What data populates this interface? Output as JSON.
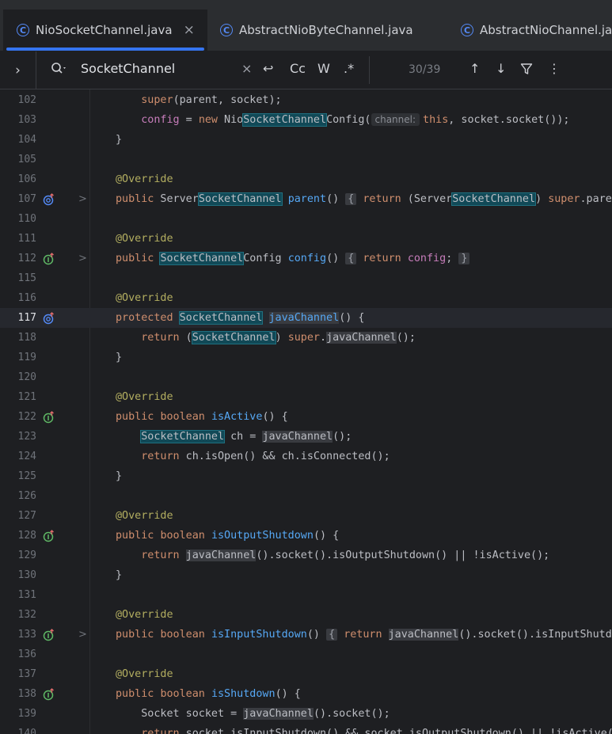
{
  "tabs": [
    {
      "label": "NioSocketChannel.java",
      "icon": "class-icon",
      "active": true,
      "close": "×"
    },
    {
      "label": "AbstractNioByteChannel.java",
      "icon": "class-icon",
      "active": false
    },
    {
      "label": "AbstractNioChannel.java",
      "icon": "class-icon",
      "active": false
    }
  ],
  "find": {
    "expand": "›",
    "query": "SocketChannel",
    "clear": "×",
    "newline": "↩",
    "case": "Cc",
    "words": "W",
    "regex": ".*",
    "count": "30/39",
    "prev": "↑",
    "next": "↓",
    "filter": "filter-icon",
    "more": "⋮"
  },
  "lines": [
    {
      "n": "102",
      "icon": "",
      "fold": false
    },
    {
      "n": "103",
      "icon": "",
      "fold": false
    },
    {
      "n": "104",
      "icon": "",
      "fold": false
    },
    {
      "n": "105",
      "icon": "",
      "fold": false
    },
    {
      "n": "106",
      "icon": "",
      "fold": false
    },
    {
      "n": "107",
      "icon": "override-icon",
      "fold": true
    },
    {
      "n": "110",
      "icon": "",
      "fold": false
    },
    {
      "n": "111",
      "icon": "",
      "fold": false
    },
    {
      "n": "112",
      "icon": "implement-icon",
      "fold": true
    },
    {
      "n": "115",
      "icon": "",
      "fold": false
    },
    {
      "n": "116",
      "icon": "",
      "fold": false
    },
    {
      "n": "117",
      "icon": "override-icon",
      "fold": false
    },
    {
      "n": "118",
      "icon": "",
      "fold": false
    },
    {
      "n": "119",
      "icon": "",
      "fold": false
    },
    {
      "n": "120",
      "icon": "",
      "fold": false
    },
    {
      "n": "121",
      "icon": "",
      "fold": false
    },
    {
      "n": "122",
      "icon": "implement-icon",
      "fold": false
    },
    {
      "n": "123",
      "icon": "",
      "fold": false
    },
    {
      "n": "124",
      "icon": "",
      "fold": false
    },
    {
      "n": "125",
      "icon": "",
      "fold": false
    },
    {
      "n": "126",
      "icon": "",
      "fold": false
    },
    {
      "n": "127",
      "icon": "",
      "fold": false
    },
    {
      "n": "128",
      "icon": "implement-icon",
      "fold": false
    },
    {
      "n": "129",
      "icon": "",
      "fold": false
    },
    {
      "n": "130",
      "icon": "",
      "fold": false
    },
    {
      "n": "131",
      "icon": "",
      "fold": false
    },
    {
      "n": "132",
      "icon": "",
      "fold": false
    },
    {
      "n": "133",
      "icon": "implement-icon",
      "fold": true
    },
    {
      "n": "136",
      "icon": "",
      "fold": false
    },
    {
      "n": "137",
      "icon": "",
      "fold": false
    },
    {
      "n": "138",
      "icon": "implement-icon",
      "fold": false
    },
    {
      "n": "139",
      "icon": "",
      "fold": false
    },
    {
      "n": "140",
      "icon": "",
      "fold": false
    }
  ],
  "code": {
    "l102": {
      "a": "super",
      "b": "(parent, socket);"
    },
    "l103": {
      "a": "config",
      "b": " = ",
      "c": "new",
      "d": " Nio",
      "e": "SocketChannel",
      "f": "Config(",
      "hint": "channel:",
      "g": "this",
      "h": ", socket.socket());"
    },
    "l104": "}",
    "override": "@Override",
    "l107": {
      "a": "public",
      "b": " Server",
      "c": "SocketChannel",
      "d": " ",
      "e": "parent",
      "f": "() ",
      "g": "{",
      "h": " ",
      "i": "return",
      "j": " (Server",
      "k": "SocketChannel",
      "l": ") ",
      "m": "super",
      "n": ".parent"
    },
    "l112": {
      "a": "public",
      "b": " ",
      "c": "SocketChannel",
      "d": "Config ",
      "e": "config",
      "f": "() ",
      "g": "{",
      "h": " ",
      "i": "return",
      "j": " ",
      "k": "config",
      "l": "; ",
      "m": "}"
    },
    "l117": {
      "a": "protected",
      "b": " ",
      "c": "SocketChannel",
      "d": " ",
      "e": "javaChannel",
      "f": "() {"
    },
    "l118": {
      "a": "return",
      "b": " (",
      "c": "SocketChannel",
      "d": ") ",
      "e": "super",
      "f": ".",
      "g": "javaChannel",
      "h": "();"
    },
    "l122": {
      "a": "public",
      "b": " ",
      "c": "boolean",
      "d": " ",
      "e": "isActive",
      "f": "() {"
    },
    "l123": {
      "a": "SocketChannel",
      "b": " ch = ",
      "c": "javaChannel",
      "d": "();"
    },
    "l124": {
      "a": "return",
      "b": " ch.isOpen() && ch.isConnected();"
    },
    "l128": {
      "a": "public",
      "b": " ",
      "c": "boolean",
      "d": " ",
      "e": "isOutputShutdown",
      "f": "() {"
    },
    "l129": {
      "a": "return",
      "b": " ",
      "c": "javaChannel",
      "d": "().socket().isOutputShutdown() || !isActive();"
    },
    "l133": {
      "a": "public",
      "b": " ",
      "c": "boolean",
      "d": " ",
      "e": "isInputShutdown",
      "f": "() ",
      "g": "{",
      "h": " ",
      "i": "return",
      "j": " ",
      "k": "javaChannel",
      "l": "().socket().isInputShutdow"
    },
    "l138": {
      "a": "public",
      "b": " ",
      "c": "boolean",
      "d": " ",
      "e": "isShutdown",
      "f": "() {"
    },
    "l139": {
      "a": "Socket socket = ",
      "b": "javaChannel",
      "c": "().socket();"
    },
    "l140": {
      "a": "return",
      "b": " socket.isInputShutdown() && socket.isOutputShutdown() || !isActive();"
    }
  },
  "colors": {
    "accent": "#3574f0",
    "match": "#114957",
    "keyword": "#cf8e6d",
    "annotation": "#b3ae60",
    "method": "#56a8f5",
    "field": "#c77dbb"
  }
}
